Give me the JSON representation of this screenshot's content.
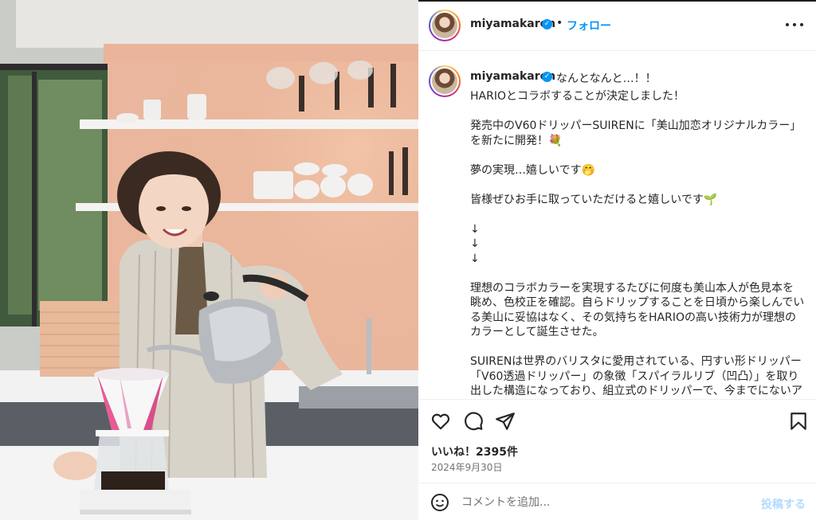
{
  "post": {
    "username": "miyamakaren",
    "follow_label": "フォロー",
    "separator": "•"
  },
  "caption": {
    "first_line": "なんとなんと…！！",
    "lines": [
      "HARIOとコラボすることが決定しました！",
      "",
      "発売中のV60ドリッパーSUIRENに「美山加恋オリジナルカラー」",
      "を新たに開発！💐",
      "",
      "夢の実現…嬉しいです🤭",
      "",
      "皆様ぜひお手に取っていただけると嬉しいです🌱",
      "",
      "↓",
      "↓",
      "↓",
      "",
      "理想のコラボカラーを実現するたびに何度も美山本人が色見本を",
      "眺め、色校正を確認。自らドリップすることを日頃から楽しんでい",
      "る美山に妥協はなく、その気持ちをHARIOの高い技術力が理想の",
      "カラーとして誕生させた。",
      "",
      "SUIRENは世界のバリスタに愛用されている、円すい形ドリッパー",
      "「V60透過ドリッパー」の象徴「スパイラルリブ（凹凸）」を取り",
      "出した構造になっており、組立式のドリッパーで、今までにないア"
    ]
  },
  "stats": {
    "likes": "いいね！2395件",
    "date": "2024年9月30日"
  },
  "comment": {
    "placeholder": "コメントを追加...",
    "post_label": "投稿する"
  },
  "icons": {
    "more": "more-options-icon",
    "like": "heart-icon",
    "comment": "comment-icon",
    "share": "send-icon",
    "save": "bookmark-icon",
    "emoji": "emoji-icon",
    "verified": "verified-badge-icon"
  },
  "colors": {
    "link": "#0095f6",
    "text": "#262626",
    "muted": "#737373",
    "post_disabled": "#b3dbff"
  }
}
